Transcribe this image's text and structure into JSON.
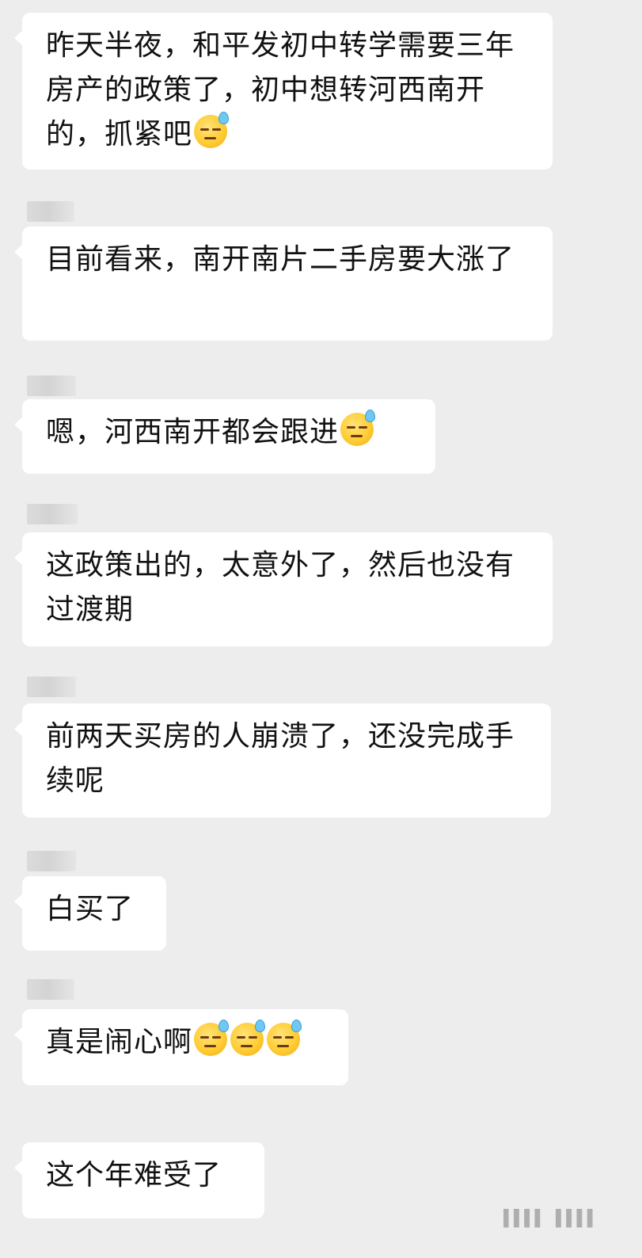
{
  "messages": [
    {
      "text": "昨天半夜，和平发初中转学需要三年房产的政策了，初中想转河西南开的，抓紧吧",
      "emoji_count": 1
    },
    {
      "text": "目前看来，南开南片二手房要大涨了",
      "emoji_count": 0
    },
    {
      "text": "嗯，河西南开都会跟进",
      "emoji_count": 1
    },
    {
      "text": "这政策出的，太意外了，然后也没有过渡期",
      "emoji_count": 0
    },
    {
      "text": "前两天买房的人崩溃了，还没完成手续呢",
      "emoji_count": 0
    },
    {
      "text": "白买了",
      "emoji_count": 0
    },
    {
      "text": "真是闹心啊",
      "emoji_count": 3
    },
    {
      "text": "这个年难受了",
      "emoji_count": 0
    }
  ],
  "emoji_icon": "sweat-smile-emoji",
  "corner_icon": "watermark-icon",
  "colors": {
    "background": "#ededed",
    "bubble": "#ffffff",
    "text": "#111111"
  }
}
